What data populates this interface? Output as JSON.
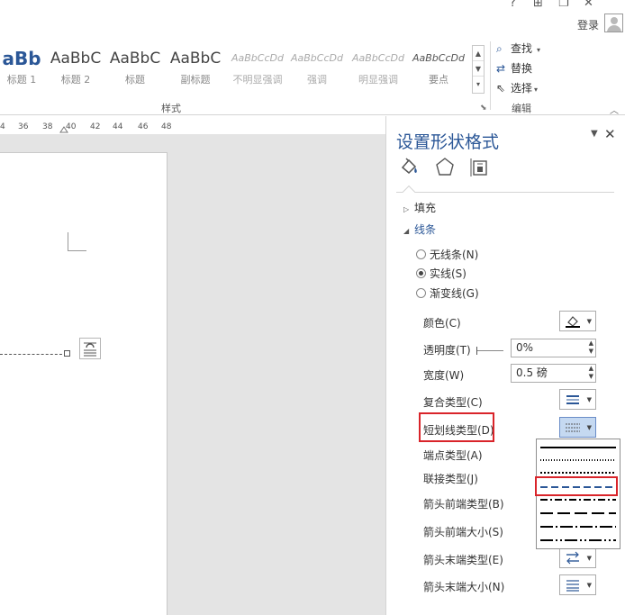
{
  "titlebar": {
    "help_icon": "?",
    "ribbon_display_icon": "⊞",
    "restore_icon": "❐",
    "close_icon": "✕",
    "login": "登录"
  },
  "ribbon": {
    "styles": [
      {
        "preview": "aBb",
        "name": "标题 1",
        "faded": false
      },
      {
        "preview": "AaBbC",
        "name": "标题 2",
        "faded": false
      },
      {
        "preview": "AaBbC",
        "name": "标题",
        "faded": false
      },
      {
        "preview": "AaBbC",
        "name": "副标题",
        "faded": false
      },
      {
        "preview": "AaBbCcDd",
        "name": "不明显强调",
        "faded": true
      },
      {
        "preview": "AaBbCcDd",
        "name": "强调",
        "faded": true
      },
      {
        "preview": "AaBbCcDd",
        "name": "明显强调",
        "faded": true
      },
      {
        "preview": "AaBbCcDd",
        "name": "要点",
        "faded": false
      }
    ],
    "styles_group_label": "样式",
    "edit": {
      "find": "查找",
      "replace": "替换",
      "select": "选择",
      "group_label": "编辑"
    }
  },
  "ruler": {
    "labels": [
      "4",
      "36",
      "38",
      "40",
      "42",
      "44",
      "46",
      "48"
    ]
  },
  "pane": {
    "title": "设置形状格式",
    "tabs": [
      "fill-line-icon",
      "effects-icon",
      "size-properties-icon"
    ],
    "fill_header": "填充",
    "line_header": "线条",
    "radios": {
      "none": "无线条(N)",
      "solid": "实线(S)",
      "gradient": "渐变线(G)"
    },
    "props": {
      "color": "颜色(C)",
      "transparency": "透明度(T)",
      "transparency_value": "0%",
      "width": "宽度(W)",
      "width_value": "0.5 磅",
      "compound": "复合类型(C)",
      "dash": "短划线类型(D)",
      "cap": "端点类型(A)",
      "join": "联接类型(J)",
      "arrow_begin_type": "箭头前端类型(B)",
      "arrow_begin_size": "箭头前端大小(S)",
      "arrow_end_type": "箭头末端类型(E)",
      "arrow_end_size": "箭头末端大小(N)"
    }
  },
  "dash_menu": {
    "options": [
      "solid",
      "round-dot",
      "square-dot",
      "dash",
      "dash-dot",
      "long-dash",
      "long-dash-dot",
      "long-dash-dot-dot"
    ],
    "selected": "dash"
  },
  "colors": {
    "accent": "#2b5797",
    "highlight_box": "#d9242a",
    "selection_fill": "#c5d9f1"
  }
}
